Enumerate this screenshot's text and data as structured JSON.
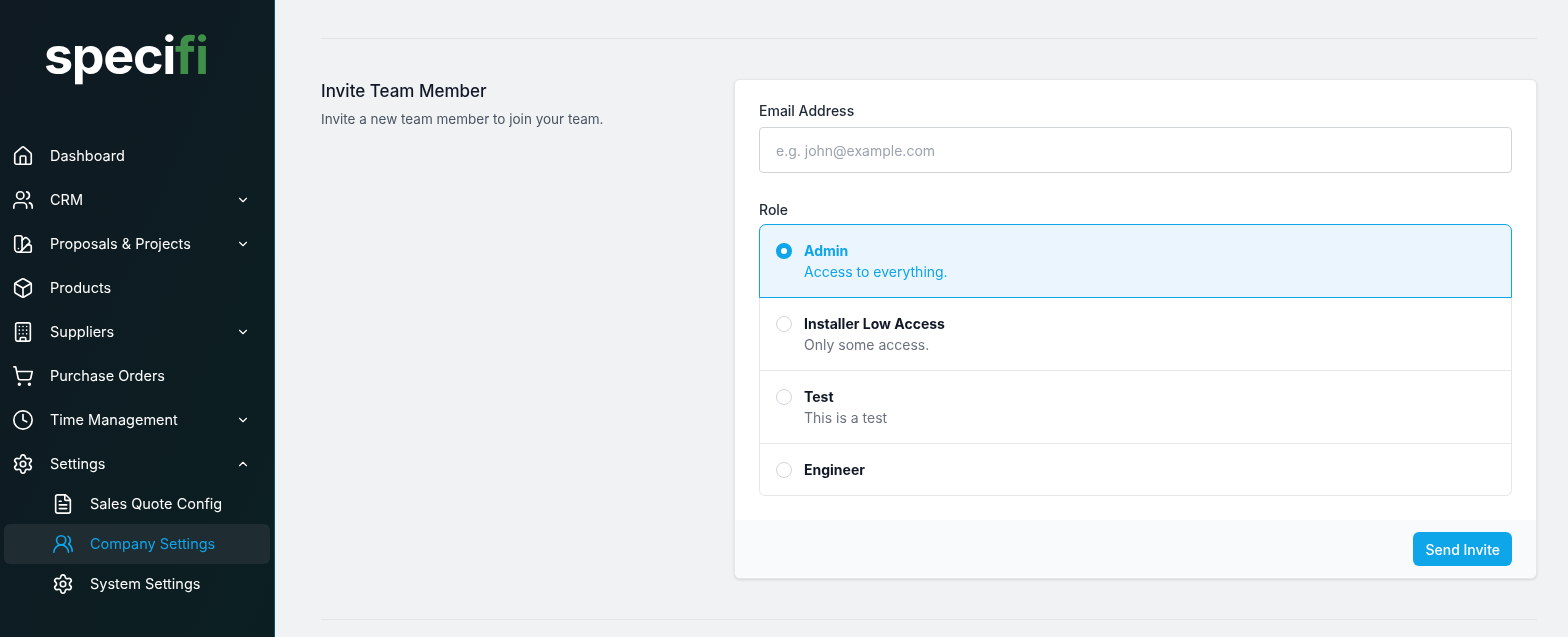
{
  "logo": {
    "main": "speci",
    "accent": "fi"
  },
  "sidebar": {
    "items": [
      {
        "label": "Dashboard",
        "kind": "home",
        "selected": false
      },
      {
        "label": "CRM",
        "kind": "users",
        "selected": false,
        "expanded": false
      },
      {
        "label": "Proposals & Projects",
        "kind": "swatch",
        "selected": false,
        "expanded": false
      },
      {
        "label": "Products",
        "kind": "box",
        "selected": false
      },
      {
        "label": "Suppliers",
        "kind": "building",
        "selected": false,
        "expanded": false
      },
      {
        "label": "Purchase Orders",
        "kind": "cart",
        "selected": false
      },
      {
        "label": "Time Management",
        "kind": "clock",
        "selected": false,
        "expanded": false
      },
      {
        "label": "Settings",
        "kind": "gear",
        "selected": false,
        "expanded": true,
        "children": [
          {
            "label": "Sales Quote Config",
            "kind": "file",
            "selected": false
          },
          {
            "label": "Company Settings",
            "kind": "people",
            "selected": true
          },
          {
            "label": "System Settings",
            "kind": "gear",
            "selected": false
          }
        ]
      }
    ]
  },
  "section": {
    "title": "Invite Team Member",
    "description": "Invite a new team member to join your team."
  },
  "form": {
    "email": {
      "label": "Email Address",
      "placeholder": "e.g. john@example.com"
    },
    "role": {
      "label": "Role",
      "options": [
        {
          "name": "Admin",
          "description": "Access to everything.",
          "selected": true
        },
        {
          "name": "Installer Low Access",
          "description": "Only some access.",
          "selected": false
        },
        {
          "name": "Test",
          "description": "This is a test",
          "selected": false
        },
        {
          "name": "Engineer",
          "selected": false
        }
      ]
    },
    "submit": "Send Invite"
  }
}
